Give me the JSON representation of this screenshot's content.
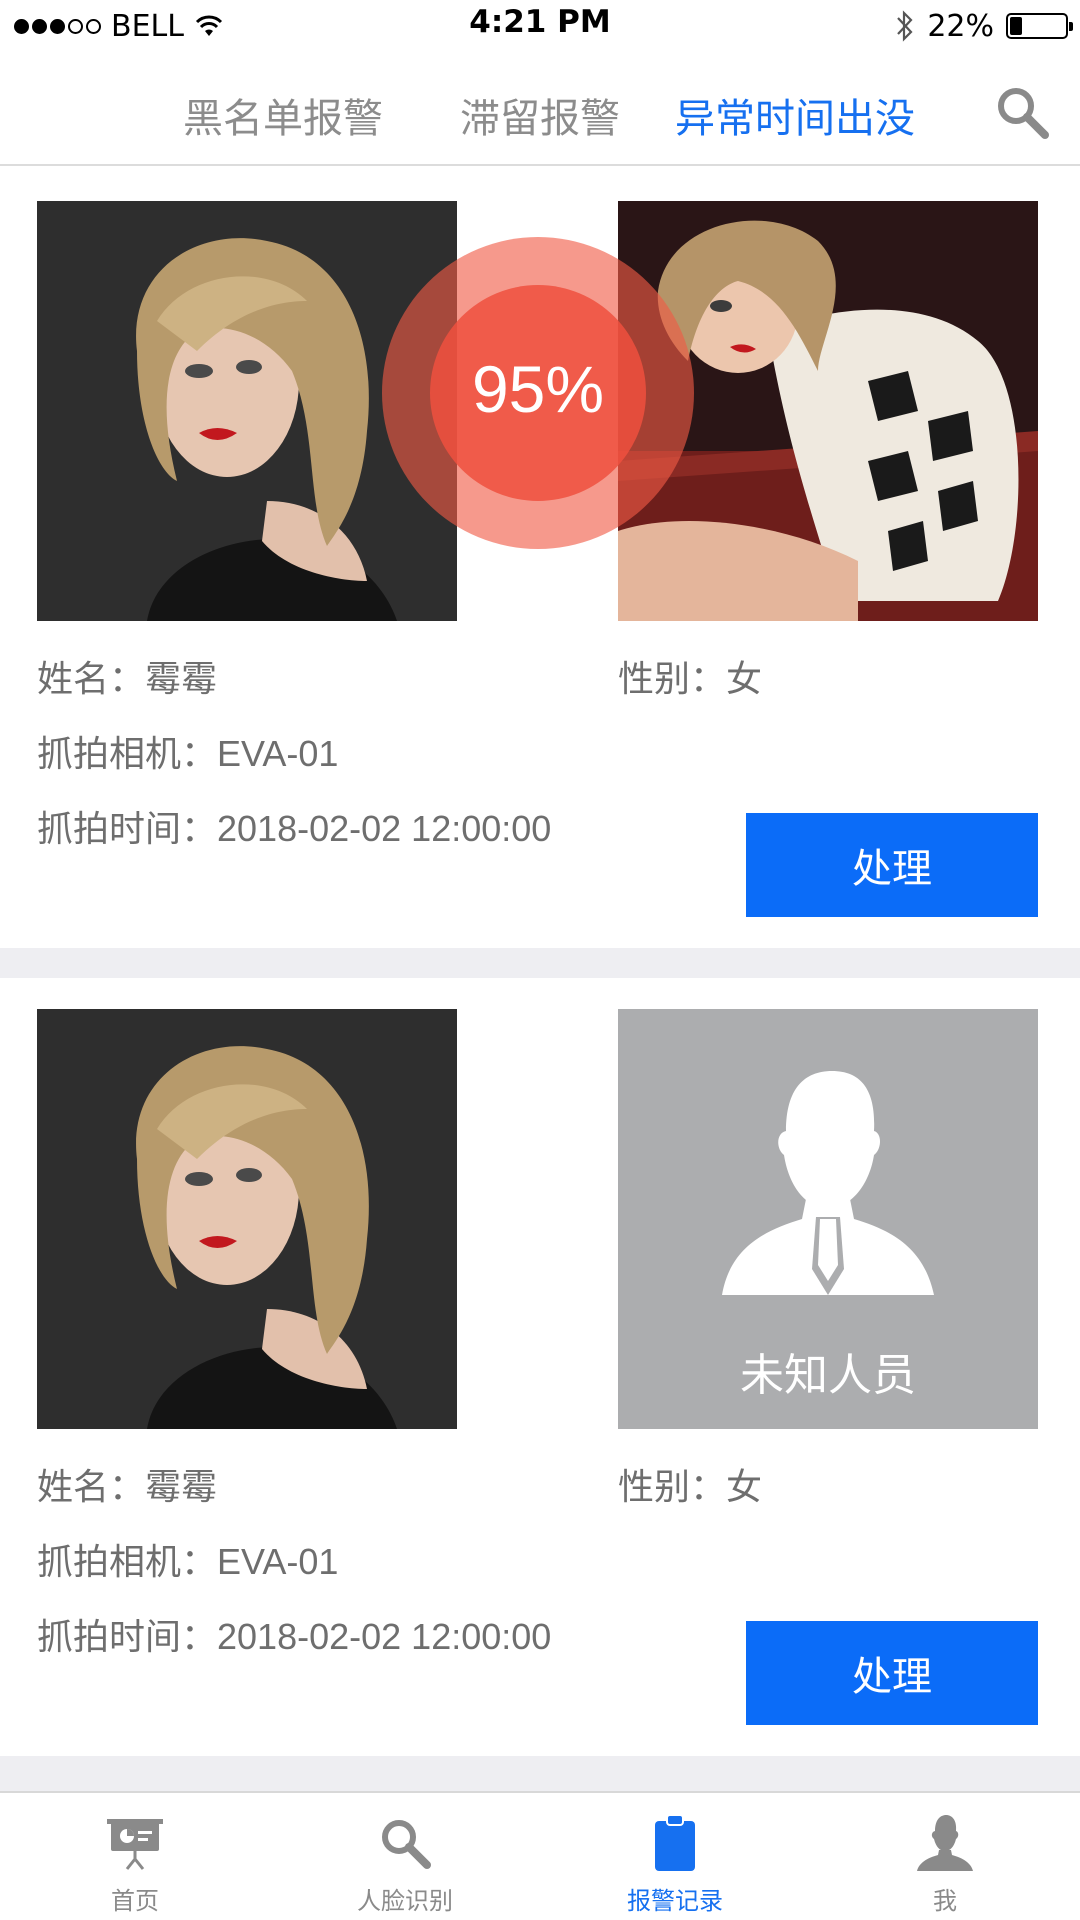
{
  "status_bar": {
    "carrier": "BELL",
    "signal_bars_filled": 3,
    "signal_bars_total": 5,
    "time": "4:21 PM",
    "battery": "22%",
    "battery_level": 0.22
  },
  "header": {
    "tabs": [
      {
        "label": "黑名单报警",
        "active": false
      },
      {
        "label": "滞留报警",
        "active": false
      },
      {
        "label": "异常时间出没",
        "active": true
      }
    ],
    "search_icon": "search-icon"
  },
  "cards": [
    {
      "match": "95%",
      "name_label": "姓名：",
      "name": "霉霉",
      "gender_label": "性别：",
      "gender": "女",
      "camera_label": "抓拍相机：",
      "camera": "EVA-01",
      "time_label": "抓拍时间：",
      "time": "2018-02-02 12:00:00",
      "action": "处理"
    },
    {
      "unknown_label": "未知人员",
      "name_label": "姓名：",
      "name": "霉霉",
      "gender_label": "性别：",
      "gender": "女",
      "camera_label": "抓拍相机：",
      "camera": "EVA-01",
      "time_label": "抓拍时间：",
      "time": "2018-02-02 12:00:00",
      "action": "处理"
    }
  ],
  "tabbar": {
    "items": [
      {
        "label": "首页",
        "icon": "presentation-icon",
        "active": false
      },
      {
        "label": "人脸识别",
        "icon": "search-icon",
        "active": false
      },
      {
        "label": "报警记录",
        "icon": "clipboard-icon",
        "active": true
      },
      {
        "label": "我",
        "icon": "user-icon",
        "active": false
      }
    ]
  },
  "colors": {
    "accent": "#1670f0",
    "button": "#0b6cf8",
    "match_ring": "#f05a46",
    "unknown_bg": "#acadaf",
    "separator": "#eeeef2"
  }
}
